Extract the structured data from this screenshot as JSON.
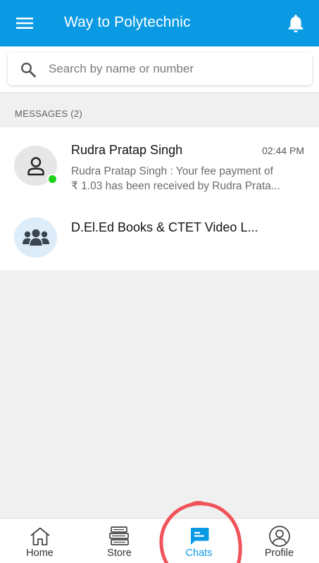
{
  "app_bar": {
    "title": "Way to Polytechnic",
    "menu_icon": "hamburger-menu-icon",
    "notification_icon": "bell-icon"
  },
  "search": {
    "placeholder": "Search by name or number",
    "value": "",
    "icon": "search-icon"
  },
  "messages_section": {
    "title": "MESSAGES (2)"
  },
  "chats": [
    {
      "name": "Rudra Pratap Singh",
      "time": "02:44 PM",
      "preview_line1": "Rudra Pratap Singh :  Your fee payment of",
      "preview_line2": "₹ 1.03 has been received by Rudra Prata...",
      "avatar_icon": "person-icon",
      "online": true
    },
    {
      "name": "D.El.Ed Books & CTET Video L...",
      "avatar_icon": "group-icon"
    }
  ],
  "bottom_nav": [
    {
      "label": "Home",
      "icon": "home-icon"
    },
    {
      "label": "Store",
      "icon": "books-icon"
    },
    {
      "label": "Chats",
      "icon": "chat-icon",
      "active": true
    },
    {
      "label": "Profile",
      "icon": "profile-icon"
    }
  ],
  "colors": {
    "primary": "#0a9ae4",
    "online": "#19d219",
    "annotation": "#f0535a",
    "background": "#f0f0f0"
  }
}
